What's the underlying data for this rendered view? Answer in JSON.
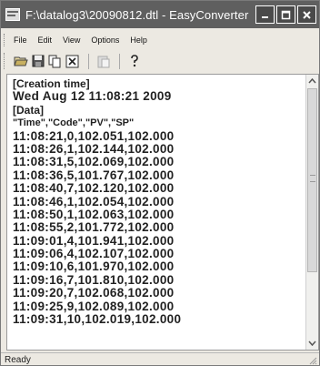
{
  "window": {
    "title": "F:\\datalog3\\20090812.dtl - EasyConverter"
  },
  "menu": {
    "items": [
      {
        "label": "File"
      },
      {
        "label": "Edit"
      },
      {
        "label": "View"
      },
      {
        "label": "Options"
      },
      {
        "label": "Help"
      }
    ]
  },
  "toolbar": {
    "buttons": [
      "open-icon",
      "save-icon",
      "copy-icon",
      "excel-icon",
      "paste-icon",
      "help-icon"
    ]
  },
  "content": {
    "lines": [
      "[Creation time]",
      "Wed Aug 12 11:08:21 2009",
      "[Data]",
      "\"Time\",\"Code\",\"PV\",\"SP\"",
      "11:08:21,0,102.051,102.000",
      "11:08:26,1,102.144,102.000",
      "11:08:31,5,102.069,102.000",
      "11:08:36,5,101.767,102.000",
      "11:08:40,7,102.120,102.000",
      "11:08:46,1,102.054,102.000",
      "11:08:50,1,102.063,102.000",
      "11:08:55,2,101.772,102.000",
      "11:09:01,4,101.941,102.000",
      "11:09:06,4,102.107,102.000",
      "11:09:10,6,101.970,102.000",
      "11:09:16,7,101.810,102.000",
      "11:09:20,7,102.068,102.000",
      "11:09:25,9,102.089,102.000",
      "11:09:31,10,102.019,102.000"
    ]
  },
  "status": {
    "text": "Ready"
  }
}
